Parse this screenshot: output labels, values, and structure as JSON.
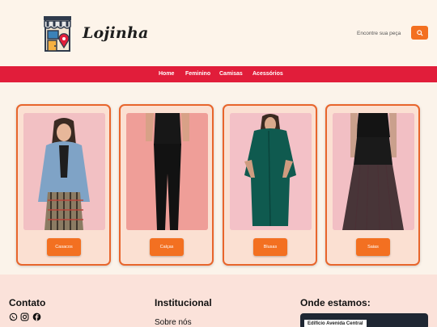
{
  "brand": {
    "name": "Lojinha",
    "logo_icon": "storefront-with-location-pin-icon"
  },
  "search": {
    "placeholder": "Encontre sua peça",
    "button_icon": "search-icon"
  },
  "nav": {
    "items": [
      "Home",
      "Feminino",
      "Camisas",
      "Acessórios"
    ]
  },
  "products": [
    {
      "button_label": "Casacos",
      "image": "woman-denim-jacket-photo"
    },
    {
      "button_label": "Calças",
      "image": "woman-black-leggings-photo"
    },
    {
      "button_label": "Blusas",
      "image": "woman-green-shirt-dress-photo"
    },
    {
      "button_label": "Saias",
      "image": "woman-black-lace-skirt-photo"
    }
  ],
  "footer": {
    "contact": {
      "heading": "Contato",
      "icons": [
        "whatsapp-icon",
        "instagram-icon",
        "facebook-icon"
      ]
    },
    "institutional": {
      "heading": "Institucional",
      "link": "Sobre nós"
    },
    "location": {
      "heading": "Onde estamos:",
      "map_label": "Edifício Avenida Central"
    }
  },
  "colors": {
    "accent": "#f37021",
    "nav": "#e11d3a",
    "card_border": "#e8652c",
    "card_bg": "#fbe0d2"
  }
}
